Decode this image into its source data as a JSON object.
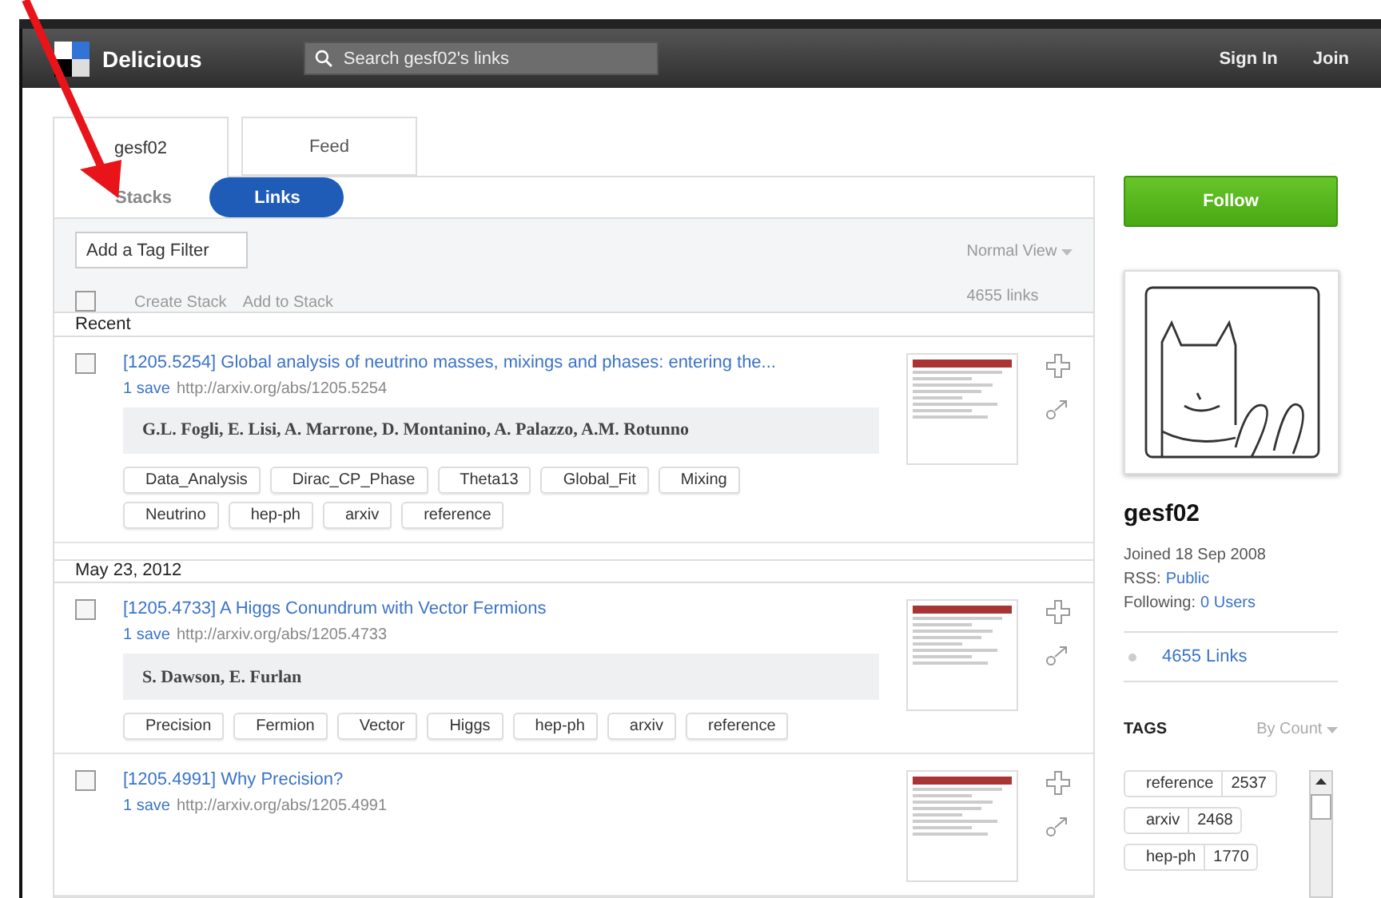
{
  "header": {
    "logo": "Delicious",
    "search": {
      "placeholder": "Search gesf02's links"
    },
    "links": [
      "Sign In",
      "Join"
    ]
  },
  "tabs": [
    {
      "label": "gesf02",
      "selected": true
    },
    {
      "label": "Feed",
      "selected": false
    }
  ],
  "view_switch": [
    {
      "label": "Stacks",
      "selected": false
    },
    {
      "label": "Links",
      "selected": true
    }
  ],
  "toolbar": {
    "tag_filter": {
      "placeholder": "Add a Tag Filter"
    },
    "select_all": {
      "checked": false
    },
    "actions": [
      "Create Stack",
      "Add to Stack"
    ],
    "view": "Normal View",
    "count": "4655 links"
  },
  "sections": [
    {
      "heading": "Recent",
      "links": [
        {
          "title": "[1205.5254] Global analysis of neutrino masses, mixings and phases: entering the...",
          "saves": "1 save",
          "url": "http://arxiv.org/abs/1205.5254",
          "authors": "G.L. Fogli, E. Lisi, A. Marrone, D. Montanino, A. Palazzo, A.M. Rotunno",
          "tags": [
            "Data_Analysis",
            "Dirac_CP_Phase",
            "Theta13",
            "Global_Fit",
            "Mixing",
            "Neutrino",
            "hep-ph",
            "arxiv",
            "reference"
          ],
          "checked": false
        }
      ]
    },
    {
      "heading": "May 23, 2012",
      "links": [
        {
          "title": "[1205.4733] A Higgs Conundrum with Vector Fermions",
          "saves": "1 save",
          "url": "http://arxiv.org/abs/1205.4733",
          "authors": "S. Dawson, E. Furlan",
          "tags": [
            "Precision",
            "Fermion",
            "Vector",
            "Higgs",
            "hep-ph",
            "arxiv",
            "reference"
          ],
          "checked": false
        },
        {
          "title": "[1205.4991] Why Precision?",
          "saves": "1 save",
          "url": "http://arxiv.org/abs/1205.4991",
          "checked": false
        }
      ]
    }
  ],
  "sidebar": {
    "follow": "Follow",
    "username": "gesf02",
    "joined": "Joined 18 Sep 2008",
    "rss_label": "RSS:",
    "rss_link": "Public",
    "following_label": "Following:",
    "following_link": "0 Users",
    "links_count": "4655 Links",
    "tags_heading": "TAGS",
    "tags_sort": "By Count",
    "tags": [
      {
        "name": "reference",
        "count": "2537"
      },
      {
        "name": "arxiv",
        "count": "2468"
      },
      {
        "name": "hep-ph",
        "count": "1770"
      }
    ]
  }
}
